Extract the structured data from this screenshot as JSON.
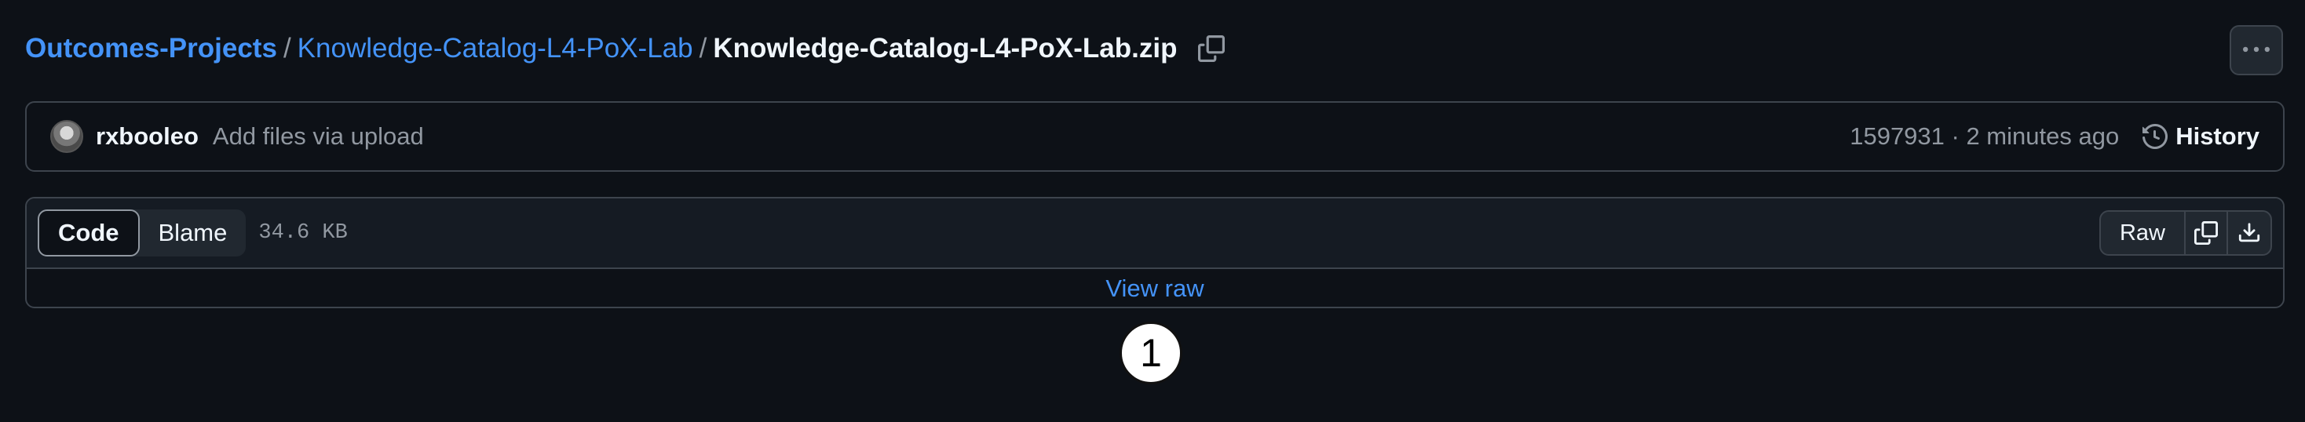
{
  "breadcrumb": {
    "owner": "Outcomes-Projects",
    "separator": "/",
    "repo": "Knowledge-Catalog-L4-PoX-Lab",
    "file": "Knowledge-Catalog-L4-PoX-Lab.zip",
    "copy_icon": "copy-icon"
  },
  "header": {
    "more_icon": "kebab-horizontal-icon"
  },
  "commit": {
    "author": "rxbooleo",
    "message": "Add files via upload",
    "meta": "1597931 · 2 minutes ago",
    "history_label": "History",
    "history_icon": "history-icon"
  },
  "file_header": {
    "tabs": [
      {
        "label": "Code",
        "active": true
      },
      {
        "label": "Blame",
        "active": false
      }
    ],
    "size": "34.6 KB",
    "raw_label": "Raw",
    "copy_icon": "copy-icon",
    "download_icon": "download-icon"
  },
  "file_body": {
    "view_raw_label": "View raw"
  },
  "annotation": {
    "marker": "1"
  },
  "colors": {
    "background": "#0d1117",
    "link": "#4493f8",
    "border": "#3d444d",
    "muted_text": "#9198a1"
  }
}
